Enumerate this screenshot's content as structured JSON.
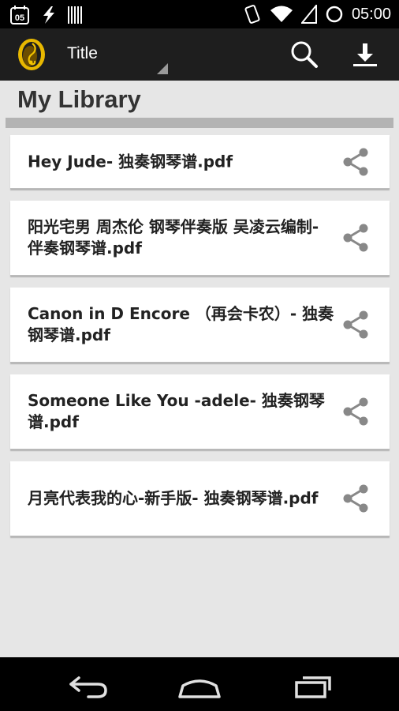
{
  "status_bar": {
    "time": "05:00",
    "left_icons": [
      "calendar-icon",
      "flash-icon",
      "barcode-icon"
    ],
    "calendar_day": "05",
    "right_icons": [
      "vibrate-icon",
      "wifi-icon",
      "signal-icon",
      "sync-icon"
    ]
  },
  "action_bar": {
    "title": "Title",
    "actions": [
      "search-icon",
      "download-icon"
    ]
  },
  "library": {
    "heading": "My Library",
    "files": [
      {
        "name": "Hey Jude- 独奏钢琴谱.pdf"
      },
      {
        "name": "阳光宅男 周杰伦 钢琴伴奏版 吴凌云编制- 伴奏钢琴谱.pdf"
      },
      {
        "name": "Canon in D Encore （再会卡农）- 独奏钢琴谱.pdf"
      },
      {
        "name": "Someone Like You -adele- 独奏钢琴谱.pdf"
      },
      {
        "name": "月亮代表我的心-新手版- 独奏钢琴谱.pdf"
      }
    ]
  },
  "nav_bar": {
    "buttons": [
      "back-icon",
      "home-icon",
      "recents-icon"
    ]
  },
  "colors": {
    "status_bar": "#000000",
    "action_bar": "#1e1e1e",
    "background": "#e6e6e6",
    "card": "#ffffff",
    "divider": "#b3b3b3",
    "share_icon": "#888888",
    "logo_gold": "#e8b800"
  }
}
